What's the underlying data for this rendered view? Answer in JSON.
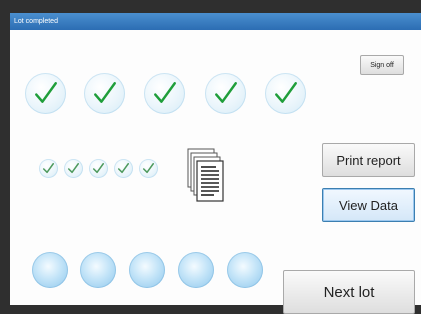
{
  "window": {
    "title": "Lot completed"
  },
  "buttons": {
    "sign_off": "Sign off",
    "print_report": "Print report",
    "view_data": "View Data",
    "next_lot": "Next lot"
  },
  "large_checks": {
    "count": 5,
    "icon": "check-icon",
    "color": "#1f9e3a"
  },
  "small_checks": {
    "count": 5,
    "icon": "check-icon",
    "color": "#4e9a5e"
  },
  "pending_items": {
    "count": 5,
    "icon": "empty-orb"
  },
  "document_icon": "document-stack-icon"
}
